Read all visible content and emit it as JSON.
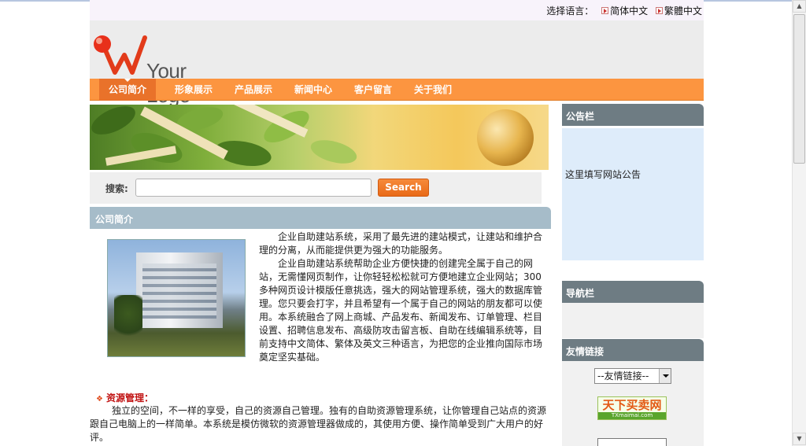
{
  "lang": {
    "label": "选择语言：",
    "simplified": "简体中文",
    "traditional": "繁體中文"
  },
  "logo": {
    "text": "Your Logo"
  },
  "nav": {
    "items": [
      {
        "label": "公司简介"
      },
      {
        "label": "形象展示"
      },
      {
        "label": "产品展示"
      },
      {
        "label": "新闻中心"
      },
      {
        "label": "客户留言"
      },
      {
        "label": "关于我们"
      }
    ]
  },
  "search": {
    "label": "搜索:",
    "value": "",
    "button": "Search"
  },
  "company": {
    "title": "公司简介",
    "para1": "企业自助建站系统，采用了最先进的建站模式，让建站和维护合理的分离，从而能提供更为强大的功能服务。",
    "para2": "企业自助建站系统帮助企业方便快捷的创建完全属于自己的网站，无需懂网页制作，让你轻轻松松就可方便地建立企业网站；300多种网页设计模版任意挑选，强大的网站管理系统，强大的数据库管理。您只要会打字，并且希望有一个属于自己的网站的朋友都可以使用。本系统融合了网上商城、产品发布、新闻发布、订单管理、栏目设置、招聘信息发布、高级防攻击留言板、自助在线编辑系统等，目前支持中文简体、繁体及英文三种语言，为把您的企业推向国际市场奠定坚实基础。",
    "resource_heading": "资源管理：",
    "resource_body": "独立的空间，不一样的享受，自己的资源自己管理。独有的自助资源管理系统，让你管理自己站点的资源跟自己电脑上的一样简单。本系统是模仿微软的资源管理器做成的，其使用方便、操作简单受到广大用户的好评。"
  },
  "sidebar": {
    "notice_title": "公告栏",
    "notice_text": "这里填写网站公告",
    "nav_title": "导航栏",
    "links_title": "友情链接",
    "links_select": "--友情链接--",
    "ad_text": "天下买卖网",
    "ad_sub": "TXmaimai.com"
  }
}
